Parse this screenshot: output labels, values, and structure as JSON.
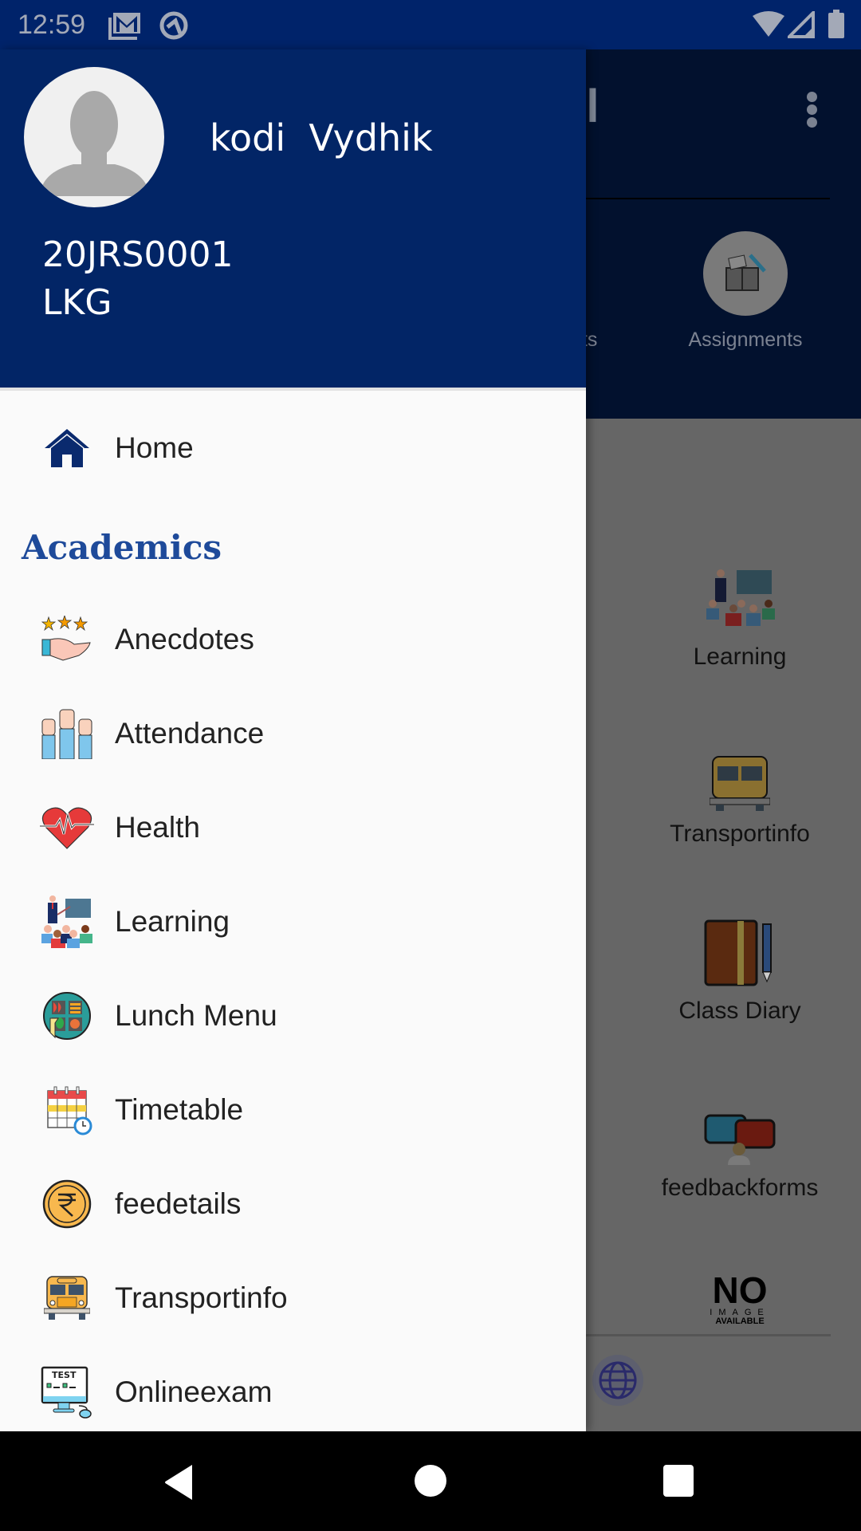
{
  "status_bar": {
    "time": "12:59",
    "icons_left": [
      "gmail-icon",
      "sync-icon"
    ],
    "icons_right": [
      "wifi-icon",
      "signal-icon",
      "battery-icon"
    ]
  },
  "background_app": {
    "title_fragment": "ol",
    "top_tiles": [
      {
        "label": "nts",
        "icon": "partial-icon"
      },
      {
        "label": "Assignments",
        "icon": "assignments-icon"
      }
    ],
    "grid_tiles": [
      {
        "label": "Learning",
        "icon": "learning-icon"
      },
      {
        "label": "Transportinfo",
        "icon": "bus-icon"
      },
      {
        "label": "Class Diary",
        "icon": "diary-icon"
      },
      {
        "label": "feedbackforms",
        "icon": "feedback-icon"
      },
      {
        "label": "NO",
        "sub1": "IMAGE",
        "sub2": "AVAILABLE",
        "icon": "no-image-icon"
      }
    ],
    "partial_label": "ts"
  },
  "drawer": {
    "user": {
      "name": "kodi  Vydhik",
      "id": "20JRS0001",
      "class": "LKG"
    },
    "home": {
      "label": "Home",
      "icon": "home-icon"
    },
    "section_title": "Academics",
    "items": [
      {
        "label": "Anecdotes",
        "icon": "anecdotes-icon"
      },
      {
        "label": "Attendance",
        "icon": "attendance-icon"
      },
      {
        "label": "Health",
        "icon": "health-icon"
      },
      {
        "label": "Learning",
        "icon": "learning-icon"
      },
      {
        "label": "Lunch Menu",
        "icon": "lunch-icon"
      },
      {
        "label": "Timetable",
        "icon": "timetable-icon"
      },
      {
        "label": "feedetails",
        "icon": "rupee-coin-icon"
      },
      {
        "label": "Transportinfo",
        "icon": "bus-icon"
      },
      {
        "label": "Onlineexam",
        "icon": "test-computer-icon"
      }
    ]
  },
  "colors": {
    "primary": "#022566",
    "section_title": "#1e4a9a",
    "drawer_bg": "#fafafa",
    "scrim": "#666666"
  }
}
